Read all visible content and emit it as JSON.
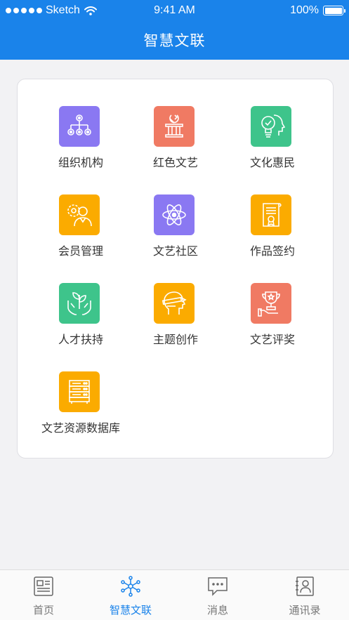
{
  "status_bar": {
    "carrier": "Sketch",
    "time": "9:41 AM",
    "battery": "100%"
  },
  "header": {
    "title": "智慧文联"
  },
  "grid": {
    "items": [
      {
        "label": "组织机构",
        "icon": "org-chart-icon",
        "color": "#8a78f2"
      },
      {
        "label": "红色文艺",
        "icon": "party-emblem-icon",
        "color": "#f07a63"
      },
      {
        "label": "文化惠民",
        "icon": "lightbulb-head-icon",
        "color": "#3ec48b"
      },
      {
        "label": "会员管理",
        "icon": "member-gear-icon",
        "color": "#fbab00"
      },
      {
        "label": "文艺社区",
        "icon": "atom-icon",
        "color": "#8a78f2"
      },
      {
        "label": "作品签约",
        "icon": "certificate-icon",
        "color": "#fbab00"
      },
      {
        "label": "人才扶持",
        "icon": "hands-sprout-icon",
        "color": "#3ec48b"
      },
      {
        "label": "主题创作",
        "icon": "head-pencil-icon",
        "color": "#fbab00"
      },
      {
        "label": "文艺评奖",
        "icon": "trophy-hand-icon",
        "color": "#f07a63"
      },
      {
        "label": "文艺资源数据库",
        "icon": "server-icon",
        "color": "#fbab00"
      }
    ]
  },
  "tabbar": {
    "accent": "#1a83ea",
    "tabs": [
      {
        "label": "首页",
        "icon": "home-icon",
        "active": false
      },
      {
        "label": "智慧文联",
        "icon": "network-icon",
        "active": true
      },
      {
        "label": "消息",
        "icon": "chat-bubble-icon",
        "active": false
      },
      {
        "label": "通讯录",
        "icon": "contact-card-icon",
        "active": false
      }
    ]
  }
}
